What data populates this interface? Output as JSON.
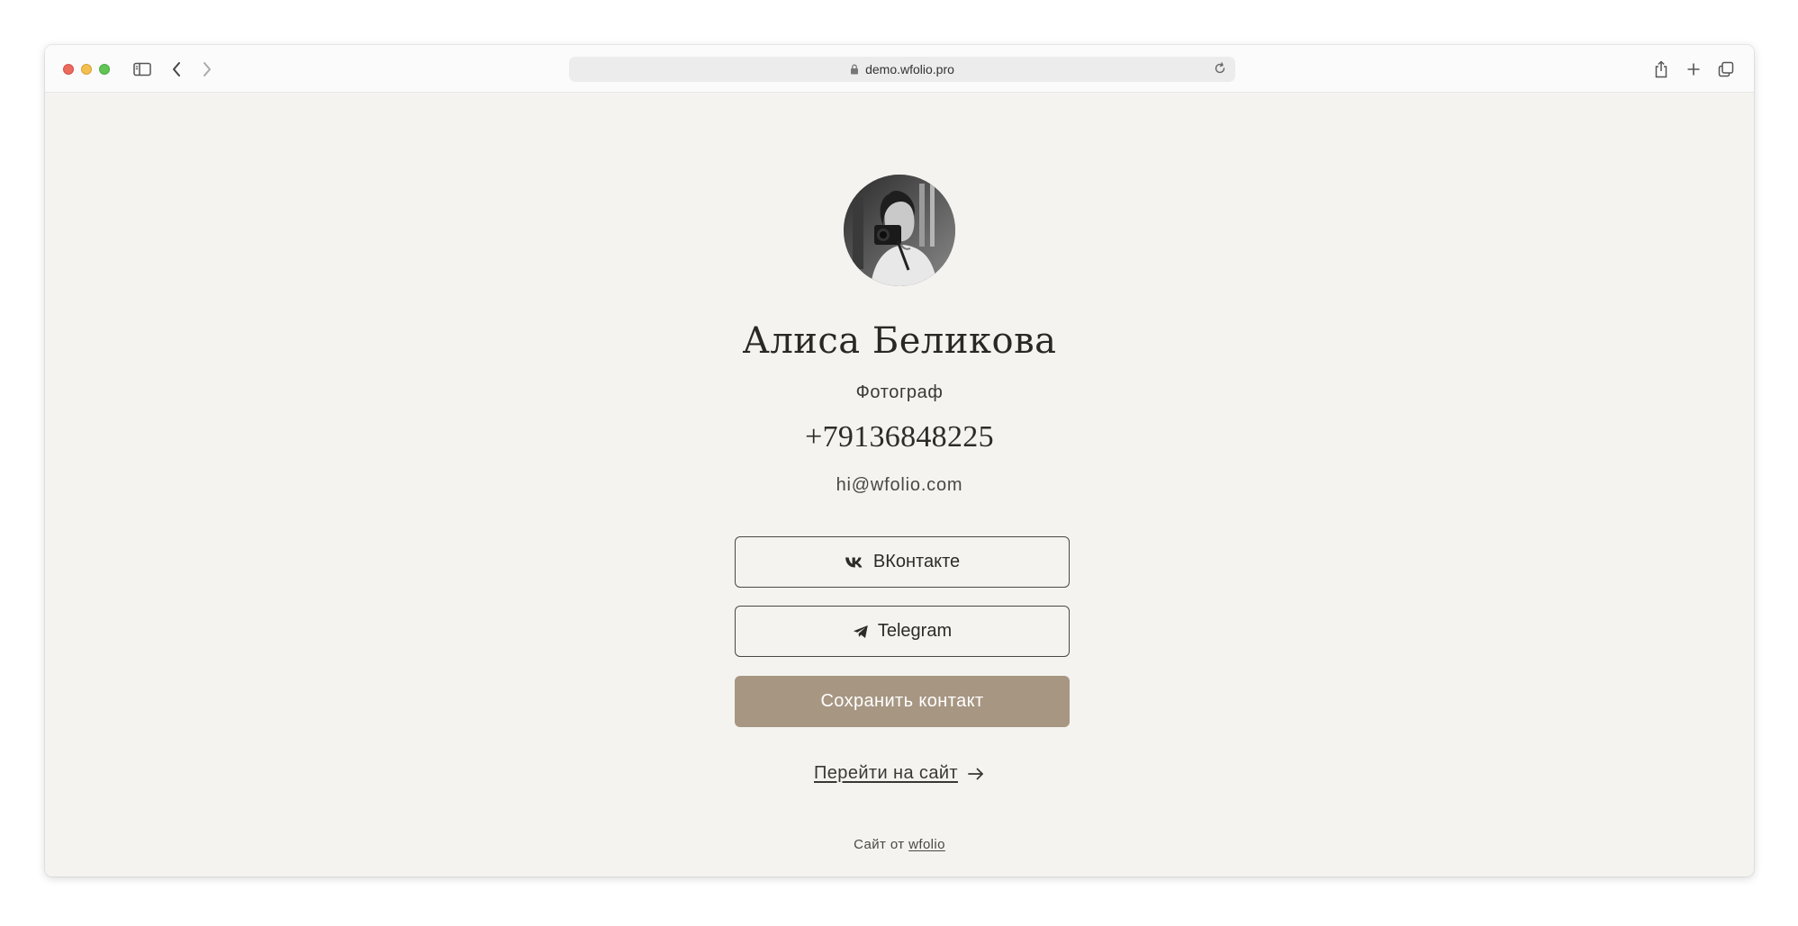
{
  "browser": {
    "url": "demo.wfolio.pro",
    "icons": {
      "sidebar": "sidebar-icon",
      "back": "chevron-left-icon",
      "forward": "chevron-right-icon",
      "lock": "lock-icon",
      "reload": "reload-icon",
      "share": "share-icon",
      "new_tab": "plus-icon",
      "tabs": "tabs-overview-icon"
    }
  },
  "profile": {
    "avatar_alt": "avatar-photo",
    "name": "Алиса Беликова",
    "role": "Фотограф",
    "phone": "+79136848225",
    "email": "hi@wfolio.com"
  },
  "buttons": {
    "vk_label": "ВКонтакте",
    "vk_icon": "vk-icon",
    "telegram_label": "Telegram",
    "telegram_icon": "telegram-icon",
    "save_label": "Сохранить контакт"
  },
  "link": {
    "go_site_label": "Перейти на сайт",
    "arrow_icon": "arrow-right-icon"
  },
  "footer": {
    "prefix": "Сайт от",
    "brand": "wfolio"
  },
  "colors": {
    "page_bg": "#f4f3f0",
    "accent_button": "#a79682",
    "text": "#2d2b28"
  }
}
